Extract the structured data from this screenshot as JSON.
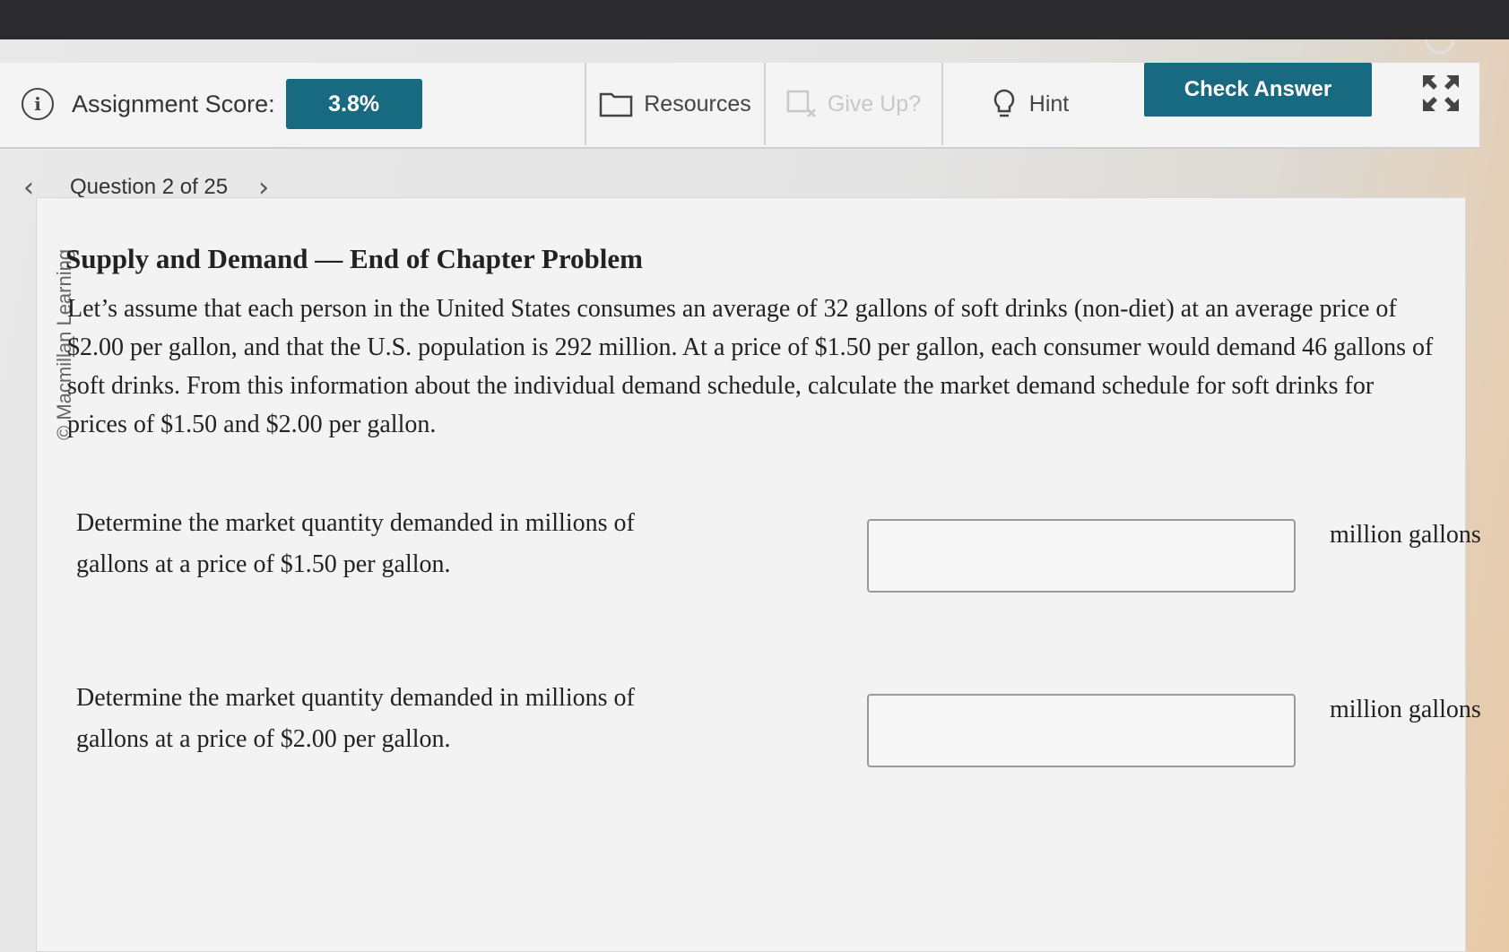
{
  "toolbar": {
    "score_label": "Assignment Score:",
    "score_value": "3.8%",
    "resources_label": "Resources",
    "give_up_label": "Give Up?",
    "hint_label": "Hint",
    "check_answer_label": "Check Answer"
  },
  "nav": {
    "question_label": "Question 2 of 25"
  },
  "content": {
    "copyright": "© Macmillan Learning",
    "title": "Supply and Demand — End of Chapter Problem",
    "body": "Let’s assume that each person in the United States consumes an average of 32 gallons of soft drinks (non-diet) at an average price of $2.00 per gallon, and that the U.S. population is 292 million. At a price of $1.50 per gallon, each consumer would demand 46 gallons of soft drinks. From this information about the individual demand schedule, calculate the market demand schedule for soft drinks for prices of $1.50 and $2.00 per gallon.",
    "questions": [
      {
        "prompt": "Determine the market quantity demanded in millions of gallons at a price of $1.50 per gallon.",
        "value": "",
        "unit": "million gallons"
      },
      {
        "prompt": "Determine the market quantity demanded in millions of gallons at a price of $2.00 per gallon.",
        "value": "",
        "unit": "million gallons"
      }
    ]
  },
  "colors": {
    "accent": "#186a80",
    "disabled": "#c8c8c8"
  },
  "icons": [
    "info-icon",
    "folder-icon",
    "give-up-icon",
    "lightbulb-icon",
    "expand-icon",
    "chevron-left-icon",
    "chevron-right-icon",
    "help-icon"
  ]
}
